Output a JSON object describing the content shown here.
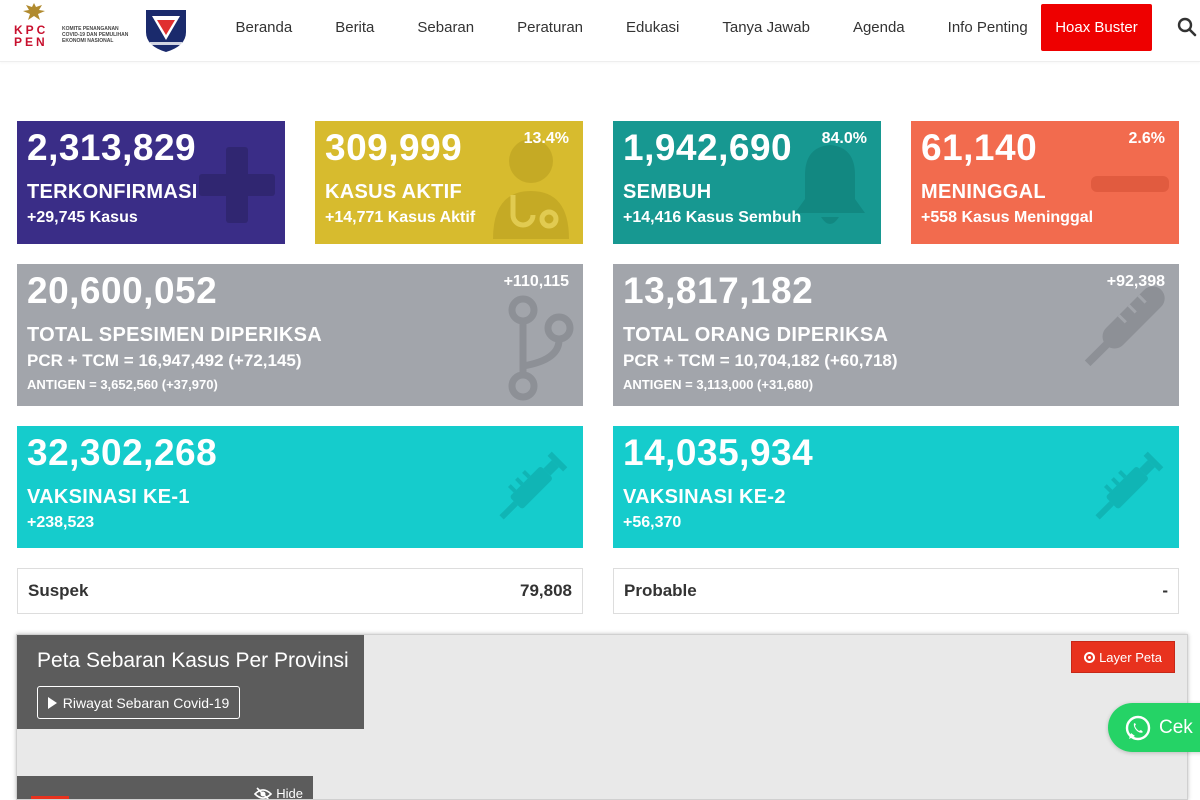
{
  "header": {
    "logo_text": "KPC PEN",
    "logo_caption": "KOMITE PENANGANAN COVID-19 DAN PEMULIHAN EKONOMI NASIONAL",
    "nav": [
      "Beranda",
      "Berita",
      "Sebaran",
      "Peraturan",
      "Edukasi",
      "Tanya Jawab",
      "Agenda",
      "Info Penting"
    ],
    "hoax_button": "Hoax Buster",
    "search_icon": "search-icon"
  },
  "cards": {
    "confirmed": {
      "value": "2,313,829",
      "label": "TERKONFIRMASI",
      "delta": "+29,745 Kasus",
      "icon": "plus-icon",
      "color": "#3a2d87"
    },
    "active": {
      "value": "309,999",
      "percent": "13.4%",
      "label": "KASUS AKTIF",
      "delta": "+14,771 Kasus Aktif",
      "icon": "doctor-icon",
      "color": "#d7bb2e"
    },
    "recovered": {
      "value": "1,942,690",
      "percent": "84.0%",
      "label": "SEMBUH",
      "delta": "+14,416 Kasus Sembuh",
      "icon": "bell-icon",
      "color": "#179891"
    },
    "deaths": {
      "value": "61,140",
      "percent": "2.6%",
      "label": "MENINGGAL",
      "delta": "+558 Kasus Meninggal",
      "icon": "minus-icon",
      "color": "#f26b4e"
    },
    "specimens": {
      "value": "20,600,052",
      "delta_top": "+110,115",
      "label": "TOTAL SPESIMEN DIPERIKSA",
      "line1": "PCR + TCM = 16,947,492 (+72,145)",
      "line2": "ANTIGEN = 3,652,560 (+37,970)",
      "icon": "branch-icon",
      "color": "#a2a5ab"
    },
    "people": {
      "value": "13,817,182",
      "delta_top": "+92,398",
      "label": "TOTAL ORANG DIPERIKSA",
      "line1": "PCR + TCM = 10,704,182 (+60,718)",
      "line2": "ANTIGEN = 3,113,000 (+31,680)",
      "icon": "thermometer-icon",
      "color": "#a2a5ab"
    },
    "vaccine1": {
      "value": "32,302,268",
      "label": "VAKSINASI KE-1",
      "delta": "+238,523",
      "icon": "syringe-icon",
      "color": "#15cccc"
    },
    "vaccine2": {
      "value": "14,035,934",
      "label": "VAKSINASI KE-2",
      "delta": "+56,370",
      "icon": "syringe-icon",
      "color": "#15cccc"
    }
  },
  "suspect": {
    "label": "Suspek",
    "value": "79,808"
  },
  "probable": {
    "label": "Probable",
    "value": "-"
  },
  "map": {
    "title": "Peta Sebaran Kasus Per Provinsi",
    "history_button": "Riwayat Sebaran Covid-19",
    "layer_button": "Layer Peta",
    "hide_button": "Hide"
  },
  "whatsapp": {
    "label": "Cek",
    "icon": "whatsapp-icon"
  }
}
